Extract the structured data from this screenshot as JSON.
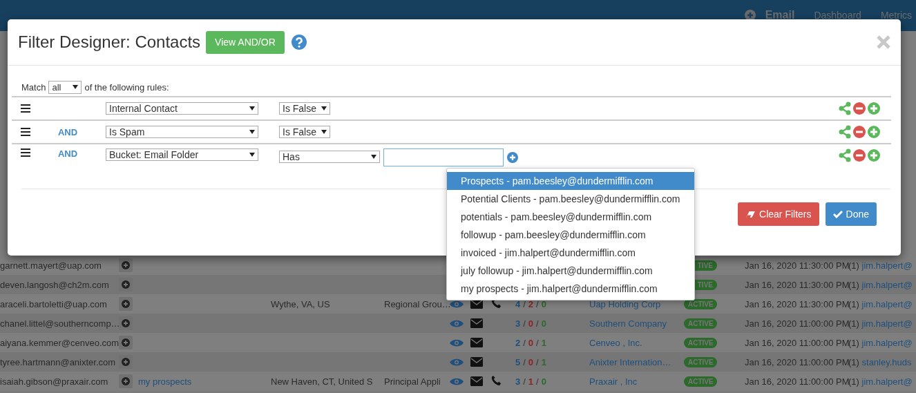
{
  "nav": {
    "items": [
      {
        "label": "Email",
        "selected": true
      },
      {
        "label": "Dashboard",
        "selected": false
      },
      {
        "label": "Metrics",
        "selected": false
      }
    ]
  },
  "dialog": {
    "title": "Filter Designer: Contacts",
    "view_button": "View AND/OR",
    "match": {
      "prefix": "Match",
      "value": "all",
      "suffix": "of the following rules:"
    },
    "rules": [
      {
        "field": "Internal Contact",
        "operator": "Is False",
        "has_value_field": false
      },
      {
        "connector": "AND",
        "field": "Is Spam",
        "operator": "Is False",
        "has_value_field": false
      },
      {
        "connector": "AND",
        "field": "Bucket: Email Folder",
        "operator": "Has",
        "has_value_field": true
      }
    ],
    "clear_button": "Clear Filters",
    "done_button": "Done"
  },
  "suggestions": [
    {
      "label": "Prospects - pam.beesley@dundermifflin.com",
      "selected": true
    },
    {
      "label": "Potential Clients - pam.beesley@dundermifflin.com",
      "selected": false
    },
    {
      "label": "potentials - pam.beesley@dundermifflin.com",
      "selected": false
    },
    {
      "label": "followup - pam.beesley@dundermifflin.com",
      "selected": false
    },
    {
      "label": "invoiced - jim.halpert@dundermifflin.com",
      "selected": false
    },
    {
      "label": "july followup - jim.halpert@dundermifflin.com",
      "selected": false
    },
    {
      "label": "my prospects - jim.halpert@dundermifflin.com",
      "selected": false
    }
  ],
  "contacts": [
    {
      "email": "garnett.mayert@uap.com",
      "status": "TIVE",
      "date": "Jan 16, 2020 11:30:00 PM",
      "owner_count": "(1)",
      "owner": "jim.halpert@"
    },
    {
      "email": "deven.langosh@ch2m.com",
      "status": "TIVE",
      "date": "Jan 16, 2020 11:30:00 PM",
      "owner_count": "(1)",
      "owner": "jim.halpert@"
    },
    {
      "email": "araceli.bartoletti@uap.com",
      "location": "Wythe, VA, US",
      "title": "Regional Grou…",
      "contact_icons": true,
      "phone": true,
      "counts": [
        "4",
        "/",
        "2",
        "/",
        "0"
      ],
      "company": "Uap Holding Corp",
      "status": "ACTIVE",
      "date": "Jan 16, 2020 11:30:00 PM",
      "owner_count": "(1)",
      "owner": "jim.halpert@"
    },
    {
      "email": "chanel.littel@southerncomp…",
      "contact_icons": true,
      "counts": [
        "3",
        "/",
        "0",
        "/",
        "0"
      ],
      "company": "Southern Company",
      "status": "ACTIVE",
      "date": "Jan 16, 2020 11:00:00 PM",
      "owner_count": "(1)",
      "owner": "jim.halpert@"
    },
    {
      "email": "aiyana.kemmer@cenveo.com",
      "contact_icons": true,
      "counts": [
        "2",
        "/",
        "0",
        "/",
        "1"
      ],
      "company": "Cenveo , Inc.",
      "status": "ACTIVE",
      "date": "Jan 16, 2020 11:00:00 PM",
      "owner_count": "(1)",
      "owner": "jim.halpert@"
    },
    {
      "email": "tyree.hartmann@anixter.com",
      "contact_icons": true,
      "counts": [
        "5",
        "/",
        "0",
        "/",
        "1"
      ],
      "company": "Anixter Internation…",
      "status": "ACTIVE",
      "date": "Jan 16, 2020 11:00:00 PM",
      "owner_count": "(1)",
      "owner": "stanley.huds"
    },
    {
      "email": "isaiah.gibson@praxair.com",
      "tag": "my prospects",
      "location": "New Haven, CT, United S",
      "title": "Principal Appli",
      "contact_icons": true,
      "phone": true,
      "counts": [
        "3",
        "/",
        "1",
        "/",
        "0"
      ],
      "company": "Praxair , Inc",
      "status": "ACTIVE",
      "date": "Jan 16, 2020 11:00:00 PM",
      "owner_count": "(1)",
      "owner": "jim.halpert@"
    }
  ]
}
